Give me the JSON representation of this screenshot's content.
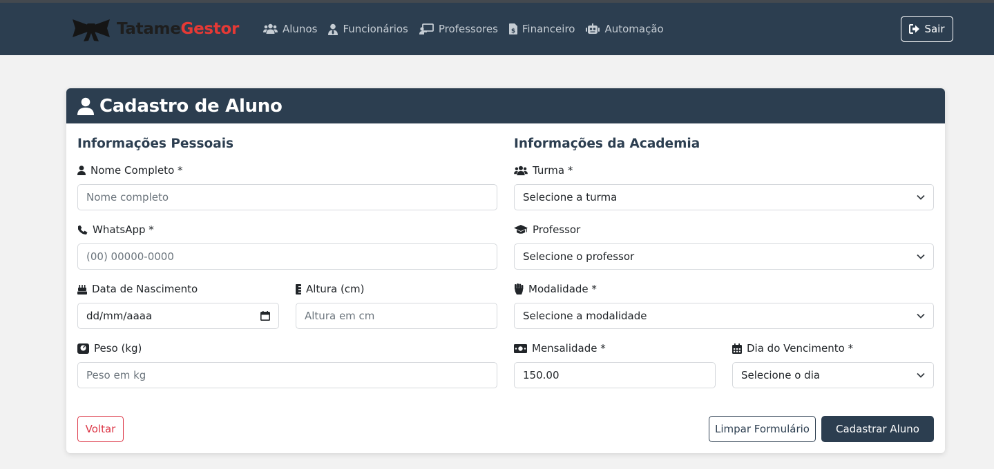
{
  "brand": {
    "part1": "Tatame",
    "part2": "Gestor"
  },
  "nav": [
    {
      "label": "Alunos",
      "icon": "users-icon"
    },
    {
      "label": "Funcionários",
      "icon": "user-tie-icon"
    },
    {
      "label": "Professores",
      "icon": "chalkboard-teacher-icon"
    },
    {
      "label": "Financeiro",
      "icon": "invoice-dollar-icon"
    },
    {
      "label": "Automação",
      "icon": "robot-icon"
    }
  ],
  "logout_label": "Sair",
  "card": {
    "title": "Cadastro de Aluno"
  },
  "personal": {
    "title": "Informações Pessoais",
    "name": {
      "label": "Nome Completo *",
      "placeholder": "Nome completo"
    },
    "whatsapp": {
      "label": "WhatsApp *",
      "placeholder": "(00) 00000-0000"
    },
    "birth": {
      "label": "Data de Nascimento",
      "value": "dd/mm/aaaa"
    },
    "height": {
      "label": "Altura (cm)",
      "placeholder": "Altura em cm"
    },
    "weight": {
      "label": "Peso (kg)",
      "placeholder": "Peso em kg"
    }
  },
  "academy": {
    "title": "Informações da Academia",
    "class": {
      "label": "Turma *",
      "value": "Selecione a turma"
    },
    "teacher": {
      "label": "Professor",
      "value": "Selecione o professor"
    },
    "modality": {
      "label": "Modalidade *",
      "value": "Selecione a modalidade"
    },
    "fee": {
      "label": "Mensalidade *",
      "value": "150.00"
    },
    "due_day": {
      "label": "Dia do Vencimento *",
      "value": "Selecione o dia"
    }
  },
  "buttons": {
    "back": "Voltar",
    "clear": "Limpar Formulário",
    "submit": "Cadastrar Aluno"
  },
  "colors": {
    "navbar": "#2c3e50",
    "brand_accent": "#e53935",
    "danger": "#dc3545"
  }
}
